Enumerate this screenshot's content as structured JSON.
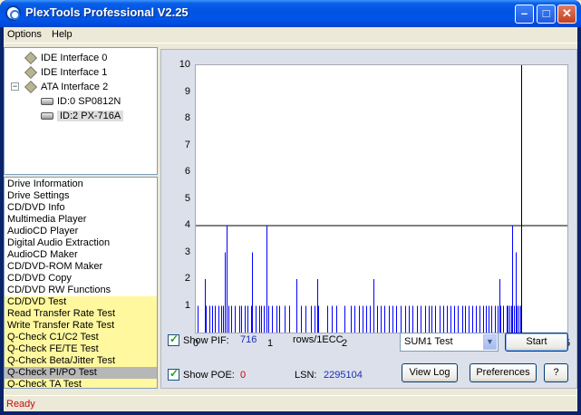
{
  "window": {
    "title": "PlexTools Professional V2.25"
  },
  "menu": {
    "options": "Options",
    "help": "Help"
  },
  "tree": {
    "items": [
      {
        "label": "IDE Interface 0"
      },
      {
        "label": "IDE Interface 1"
      },
      {
        "label": "ATA Interface 2"
      },
      {
        "label": "ID:0  SP0812N"
      },
      {
        "label": "ID:2  PX-716A"
      }
    ]
  },
  "functions": [
    "Drive Information",
    "Drive Settings",
    "CD/DVD Info",
    "Multimedia Player",
    "AudioCD Player",
    "Digital Audio Extraction",
    "AudioCD Maker",
    "CD/DVD-ROM Maker",
    "CD/DVD Copy",
    "CD/DVD RW Functions",
    "CD/DVD Test",
    "Read Transfer Rate Test",
    "Write Transfer Rate Test",
    "Q-Check C1/C2 Test",
    "Q-Check FE/TE Test",
    "Q-Check Beta/Jitter Test",
    "Q-Check PI/PO Test",
    "Q-Check TA Test"
  ],
  "chart_data": {
    "type": "bar",
    "xlim": [
      0,
      5
    ],
    "ylim": [
      0,
      10
    ],
    "xticks": [
      "0",
      "1",
      "2",
      "3",
      "4",
      "5"
    ],
    "yticks": [
      "1",
      "2",
      "3",
      "4",
      "5",
      "6",
      "7",
      "8",
      "9",
      "10"
    ],
    "threshold": 4,
    "marker_x": 4.38,
    "bar_color": "#0000FF",
    "bars": [
      [
        0.03,
        1
      ],
      [
        0.12,
        2
      ],
      [
        0.13,
        1
      ],
      [
        0.18,
        1
      ],
      [
        0.22,
        1
      ],
      [
        0.26,
        1
      ],
      [
        0.3,
        1
      ],
      [
        0.34,
        1
      ],
      [
        0.36,
        1
      ],
      [
        0.39,
        3
      ],
      [
        0.41,
        4
      ],
      [
        0.44,
        1
      ],
      [
        0.48,
        1
      ],
      [
        0.52,
        1
      ],
      [
        0.58,
        1
      ],
      [
        0.61,
        1
      ],
      [
        0.66,
        1
      ],
      [
        0.69,
        1
      ],
      [
        0.74,
        1
      ],
      [
        0.76,
        3
      ],
      [
        0.8,
        1
      ],
      [
        0.85,
        1
      ],
      [
        0.88,
        1
      ],
      [
        0.91,
        1
      ],
      [
        0.95,
        4
      ],
      [
        0.98,
        1
      ],
      [
        1.02,
        1
      ],
      [
        1.08,
        1
      ],
      [
        1.12,
        1
      ],
      [
        1.2,
        1
      ],
      [
        1.26,
        1
      ],
      [
        1.35,
        2
      ],
      [
        1.41,
        1
      ],
      [
        1.48,
        1
      ],
      [
        1.55,
        1
      ],
      [
        1.6,
        1
      ],
      [
        1.63,
        2
      ],
      [
        1.65,
        1
      ],
      [
        1.77,
        1
      ],
      [
        1.83,
        1
      ],
      [
        1.89,
        1
      ],
      [
        2.0,
        1
      ],
      [
        2.08,
        1
      ],
      [
        2.13,
        1
      ],
      [
        2.19,
        1
      ],
      [
        2.24,
        1
      ],
      [
        2.29,
        1
      ],
      [
        2.34,
        1
      ],
      [
        2.39,
        2
      ],
      [
        2.44,
        1
      ],
      [
        2.49,
        1
      ],
      [
        2.54,
        1
      ],
      [
        2.6,
        1
      ],
      [
        2.65,
        1
      ],
      [
        2.7,
        1
      ],
      [
        2.76,
        1
      ],
      [
        2.82,
        1
      ],
      [
        2.87,
        1
      ],
      [
        2.92,
        1
      ],
      [
        2.97,
        1
      ],
      [
        3.02,
        1
      ],
      [
        3.08,
        1
      ],
      [
        3.13,
        1
      ],
      [
        3.17,
        1
      ],
      [
        3.22,
        1
      ],
      [
        3.28,
        1
      ],
      [
        3.33,
        1
      ],
      [
        3.38,
        1
      ],
      [
        3.43,
        1
      ],
      [
        3.48,
        1
      ],
      [
        3.53,
        1
      ],
      [
        3.58,
        1
      ],
      [
        3.62,
        1
      ],
      [
        3.67,
        1
      ],
      [
        3.72,
        1
      ],
      [
        3.77,
        1
      ],
      [
        3.82,
        1
      ],
      [
        3.86,
        1
      ],
      [
        3.9,
        1
      ],
      [
        3.94,
        1
      ],
      [
        3.98,
        1
      ],
      [
        4.02,
        1
      ],
      [
        4.06,
        1
      ],
      [
        4.08,
        2
      ],
      [
        4.1,
        1
      ],
      [
        4.14,
        1
      ],
      [
        4.18,
        1
      ],
      [
        4.2,
        1
      ],
      [
        4.22,
        1
      ],
      [
        4.24,
        1
      ],
      [
        4.26,
        4
      ],
      [
        4.28,
        1
      ],
      [
        4.3,
        3
      ],
      [
        4.32,
        1
      ],
      [
        4.34,
        1
      ],
      [
        4.36,
        1
      ]
    ]
  },
  "controls": {
    "show_pif_label": "Show PIF:",
    "pif_value": "716",
    "rows_label": "rows/1ECC",
    "show_poe_label": "Show POE:",
    "poe_value": "0",
    "lsn_label": "LSN:",
    "lsn_value": "2295104",
    "test_select": "SUM1 Test",
    "start_label": "Start",
    "view_log_label": "View Log",
    "preferences_label": "Preferences",
    "help_label": "?"
  },
  "status": {
    "text": "Ready"
  }
}
